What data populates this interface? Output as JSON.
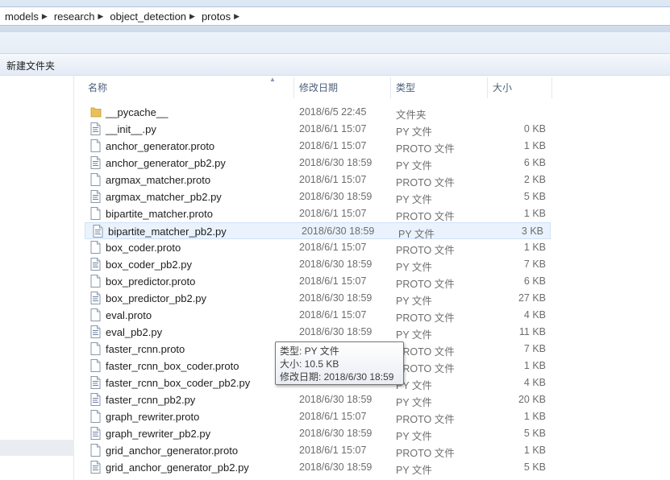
{
  "address": {
    "crumbs": [
      "models",
      "research",
      "object_detection",
      "protos"
    ]
  },
  "toolbar": {
    "new_folder": "新建文件夹"
  },
  "columns": {
    "name": "名称",
    "date": "修改日期",
    "type": "类型",
    "size": "大小"
  },
  "files": [
    {
      "name": "__pycache__",
      "date": "2018/6/5 22:45",
      "type": "文件夹",
      "size": "",
      "kind": "folder-icon"
    },
    {
      "name": "__init__.py",
      "date": "2018/6/1 15:07",
      "type": "PY 文件",
      "size": "0 KB",
      "kind": "py-file-icon"
    },
    {
      "name": "anchor_generator.proto",
      "date": "2018/6/1 15:07",
      "type": "PROTO 文件",
      "size": "1 KB",
      "kind": "proto-file-icon"
    },
    {
      "name": "anchor_generator_pb2.py",
      "date": "2018/6/30 18:59",
      "type": "PY 文件",
      "size": "6 KB",
      "kind": "py-file-icon"
    },
    {
      "name": "argmax_matcher.proto",
      "date": "2018/6/1 15:07",
      "type": "PROTO 文件",
      "size": "2 KB",
      "kind": "proto-file-icon"
    },
    {
      "name": "argmax_matcher_pb2.py",
      "date": "2018/6/30 18:59",
      "type": "PY 文件",
      "size": "5 KB",
      "kind": "py-file-icon"
    },
    {
      "name": "bipartite_matcher.proto",
      "date": "2018/6/1 15:07",
      "type": "PROTO 文件",
      "size": "1 KB",
      "kind": "proto-file-icon"
    },
    {
      "name": "bipartite_matcher_pb2.py",
      "date": "2018/6/30 18:59",
      "type": "PY 文件",
      "size": "3 KB",
      "kind": "py-file-icon"
    },
    {
      "name": "box_coder.proto",
      "date": "2018/6/1 15:07",
      "type": "PROTO 文件",
      "size": "1 KB",
      "kind": "proto-file-icon"
    },
    {
      "name": "box_coder_pb2.py",
      "date": "2018/6/30 18:59",
      "type": "PY 文件",
      "size": "7 KB",
      "kind": "py-file-icon"
    },
    {
      "name": "box_predictor.proto",
      "date": "2018/6/1 15:07",
      "type": "PROTO 文件",
      "size": "6 KB",
      "kind": "proto-file-icon"
    },
    {
      "name": "box_predictor_pb2.py",
      "date": "2018/6/30 18:59",
      "type": "PY 文件",
      "size": "27 KB",
      "kind": "py-file-icon"
    },
    {
      "name": "eval.proto",
      "date": "2018/6/1 15:07",
      "type": "PROTO 文件",
      "size": "4 KB",
      "kind": "proto-file-icon"
    },
    {
      "name": "eval_pb2.py",
      "date": "2018/6/30 18:59",
      "type": "PY 文件",
      "size": "11 KB",
      "kind": "py-file-icon"
    },
    {
      "name": "faster_rcnn.proto",
      "date": "",
      "type": "PROTO 文件",
      "size": "7 KB",
      "kind": "proto-file-icon"
    },
    {
      "name": "faster_rcnn_box_coder.proto",
      "date": "",
      "type": "PROTO 文件",
      "size": "1 KB",
      "kind": "proto-file-icon"
    },
    {
      "name": "faster_rcnn_box_coder_pb2.py",
      "date": "",
      "type": "PY 文件",
      "size": "4 KB",
      "kind": "py-file-icon"
    },
    {
      "name": "faster_rcnn_pb2.py",
      "date": "2018/6/30 18:59",
      "type": "PY 文件",
      "size": "20 KB",
      "kind": "py-file-icon"
    },
    {
      "name": "graph_rewriter.proto",
      "date": "2018/6/1 15:07",
      "type": "PROTO 文件",
      "size": "1 KB",
      "kind": "proto-file-icon"
    },
    {
      "name": "graph_rewriter_pb2.py",
      "date": "2018/6/30 18:59",
      "type": "PY 文件",
      "size": "5 KB",
      "kind": "py-file-icon"
    },
    {
      "name": "grid_anchor_generator.proto",
      "date": "2018/6/1 15:07",
      "type": "PROTO 文件",
      "size": "1 KB",
      "kind": "proto-file-icon"
    },
    {
      "name": "grid_anchor_generator_pb2.py",
      "date": "2018/6/30 18:59",
      "type": "PY 文件",
      "size": "5 KB",
      "kind": "py-file-icon"
    }
  ],
  "selected_index": 7,
  "tooltip": {
    "type_line": "类型: PY 文件",
    "size_line": "大小: 10.5 KB",
    "date_line": "修改日期: 2018/6/30 18:59"
  },
  "colors": {
    "selection": "#eaf3fd",
    "header_text": "#4c607a",
    "folder": "#e8c15a"
  }
}
